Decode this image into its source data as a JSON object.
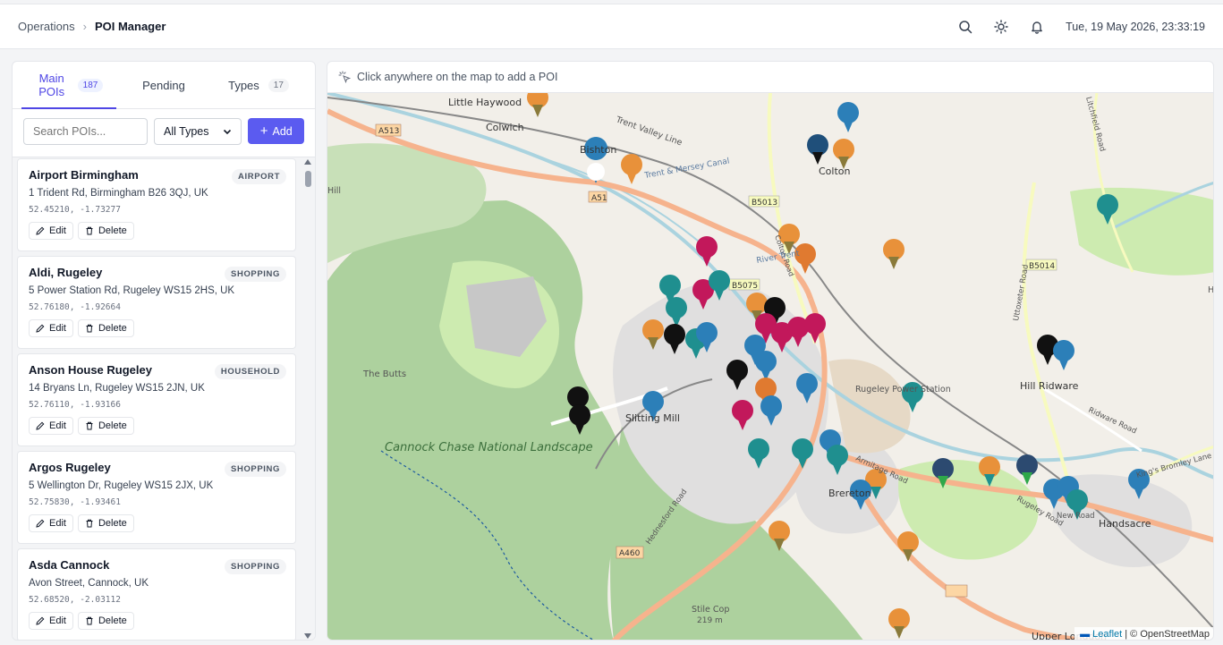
{
  "breadcrumb": {
    "parent": "Operations",
    "separator": "›",
    "current": "POI Manager"
  },
  "header": {
    "datetime": "Tue, 19 May 2026, 23:33:19"
  },
  "tabs": [
    {
      "label": "Main POIs",
      "badge": "187"
    },
    {
      "label": "Pending",
      "badge": ""
    },
    {
      "label": "Types",
      "badge": "17"
    }
  ],
  "controls": {
    "search_placeholder": "Search POIs...",
    "type_filter": "All Types",
    "add_label": "Add"
  },
  "actions": {
    "edit": "Edit",
    "delete": "Delete"
  },
  "pois": [
    {
      "name": "Airport Birmingham",
      "type": "AIRPORT",
      "address": "1 Trident Rd, Birmingham B26 3QJ, UK",
      "coords": "52.45210, -1.73277"
    },
    {
      "name": "Aldi, Rugeley",
      "type": "SHOPPING",
      "address": "5 Power Station Rd, Rugeley WS15 2HS, UK",
      "coords": "52.76180, -1.92664"
    },
    {
      "name": "Anson House Rugeley",
      "type": "HOUSEHOLD",
      "address": "14 Bryans Ln, Rugeley WS15 2JN, UK",
      "coords": "52.76110, -1.93166"
    },
    {
      "name": "Argos Rugeley",
      "type": "SHOPPING",
      "address": "5 Wellington Dr, Rugeley WS15 2JX, UK",
      "coords": "52.75830, -1.93461"
    },
    {
      "name": "Asda Cannock",
      "type": "SHOPPING",
      "address": "Avon Street, Cannock, UK",
      "coords": "52.68520, -2.03112"
    }
  ],
  "map": {
    "hint": "Click anywhere on the map to add a POI",
    "attribution_leaflet": "Leaflet",
    "attribution_rest": "| © OpenStreetMap",
    "labels": [
      "Little Haywood",
      "Colwich",
      "Bishton",
      "Trent Valley Line",
      "Trent & Mersey Canal",
      "Colton",
      "Colton Road",
      "A513",
      "A51",
      "B5013",
      "B5014",
      "B5075",
      "The Butts",
      "Slitting Mill",
      "Rugeley Power Station",
      "Hill Ridware",
      "Ridware Road",
      "Cannock Chase National Landscape",
      "Hednesford Road",
      "A460",
      "Stile Cop",
      "219 m",
      "Brereton",
      "Handsacre",
      "Rugeley Road",
      "New Road",
      "King's Bromley Lane",
      "Upper Longdon",
      "Uttoxeter Road",
      "River Trent",
      "Litchfield Road",
      "Armitage Road",
      "Hill",
      "Hl"
    ]
  }
}
